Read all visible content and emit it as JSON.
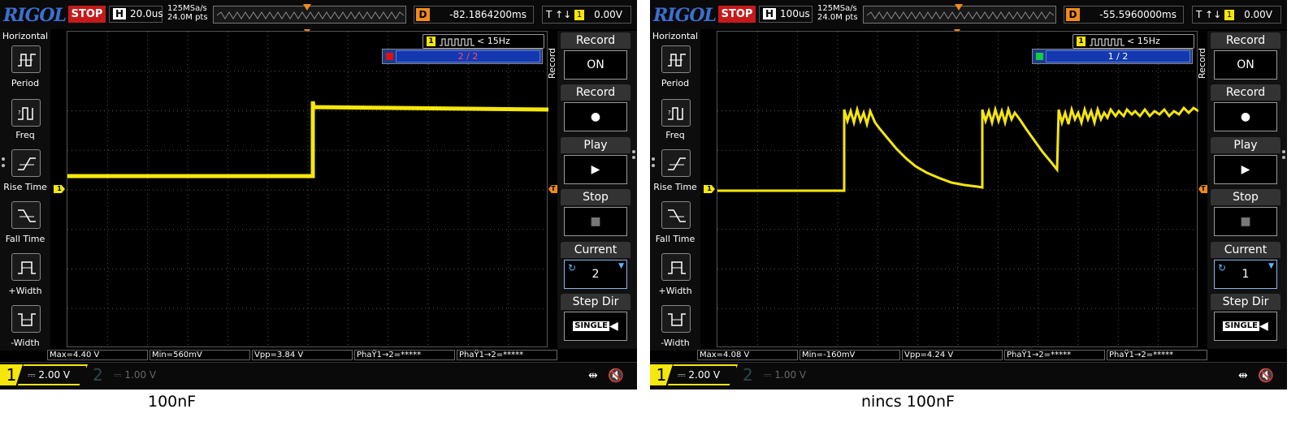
{
  "scopes": [
    {
      "id": "left",
      "brand": "RIGOL",
      "run_state": "STOP",
      "horizontal": {
        "label": "H",
        "timebase": "20.0us"
      },
      "sample_rate": "125MSa/s",
      "memory_depth": "24.0M pts",
      "delay": {
        "label": "D",
        "value": "-82.1864200ms"
      },
      "trigger": {
        "label": "T",
        "icon": "trigger-edge-icon",
        "source": "1",
        "level": "0.00V"
      },
      "sidebar": {
        "title": "Horizontal",
        "items": [
          {
            "label": "Period",
            "icon": "period-icon"
          },
          {
            "label": "Freq",
            "icon": "frequency-icon"
          },
          {
            "label": "Rise Time",
            "icon": "rise-time-icon"
          },
          {
            "label": "Fall Time",
            "icon": "fall-time-icon"
          },
          {
            "label": "+Width",
            "icon": "positive-width-icon"
          },
          {
            "label": "-Width",
            "icon": "negative-width-icon"
          }
        ]
      },
      "freq_readout": {
        "channel": "1",
        "value": "< 15Hz"
      },
      "frame_counter": {
        "text": "2 / 2",
        "color": "#e01010",
        "text_color": "#ff4a6a"
      },
      "record_menu": {
        "side_label": "Record",
        "items": [
          {
            "title": "Record",
            "value": "ON"
          },
          {
            "title": "Record",
            "value": "●"
          },
          {
            "title": "Play",
            "value": "▶"
          },
          {
            "title": "Stop",
            "value": "■"
          },
          {
            "title": "Current",
            "value": "2"
          },
          {
            "title": "Step Dir",
            "value": "SINGLE"
          }
        ]
      },
      "measurements": [
        "Max=4.40 V",
        "Min=560mV",
        "Vpp=3.84 V",
        "PhaŸ1→2=*****",
        "PhaŸ1→2=*****"
      ],
      "channels": [
        {
          "num": "1",
          "scale": "2.00 V",
          "color": "#f5e70a",
          "active": true
        },
        {
          "num": "2",
          "scale": "1.00 V",
          "color": "#2a4a4a",
          "active": false
        }
      ],
      "waveform": {
        "type": "step",
        "low_level_div": 0.15,
        "high_level_div": 1.65,
        "step_at_div": 6.1
      },
      "caption": "100nF"
    },
    {
      "id": "right",
      "brand": "RIGOL",
      "run_state": "STOP",
      "horizontal": {
        "label": "H",
        "timebase": "100us"
      },
      "sample_rate": "125MSa/s",
      "memory_depth": "24.0M pts",
      "delay": {
        "label": "D",
        "value": "-55.5960000ms"
      },
      "trigger": {
        "label": "T",
        "icon": "trigger-edge-icon",
        "source": "1",
        "level": "0.00V"
      },
      "sidebar": {
        "title": "Horizontal",
        "items": [
          {
            "label": "Period",
            "icon": "period-icon"
          },
          {
            "label": "Freq",
            "icon": "frequency-icon"
          },
          {
            "label": "Rise Time",
            "icon": "rise-time-icon"
          },
          {
            "label": "Fall Time",
            "icon": "fall-time-icon"
          },
          {
            "label": "+Width",
            "icon": "positive-width-icon"
          },
          {
            "label": "-Width",
            "icon": "negative-width-icon"
          }
        ]
      },
      "freq_readout": {
        "channel": "1",
        "value": "< 15Hz"
      },
      "frame_counter": {
        "text": "1 / 2",
        "color": "#10d040",
        "text_color": "#ffffff"
      },
      "record_menu": {
        "side_label": "Record",
        "items": [
          {
            "title": "Record",
            "value": "ON"
          },
          {
            "title": "Record",
            "value": "●"
          },
          {
            "title": "Play",
            "value": "▶"
          },
          {
            "title": "Stop",
            "value": "■"
          },
          {
            "title": "Current",
            "value": "1"
          },
          {
            "title": "Step Dir",
            "value": "SINGLE"
          }
        ]
      },
      "measurements": [
        "Max=4.08 V",
        "Min=-160mV",
        "Vpp=4.24 V",
        "PhaŸ1→2=*****",
        "PhaŸ1→2=*****"
      ],
      "channels": [
        {
          "num": "1",
          "scale": "2.00 V",
          "color": "#f5e70a",
          "active": true
        },
        {
          "num": "2",
          "scale": "1.00 V",
          "color": "#2a4a4a",
          "active": false
        }
      ],
      "waveform": {
        "type": "decay"
      },
      "caption": "nincs 100nF"
    }
  ]
}
